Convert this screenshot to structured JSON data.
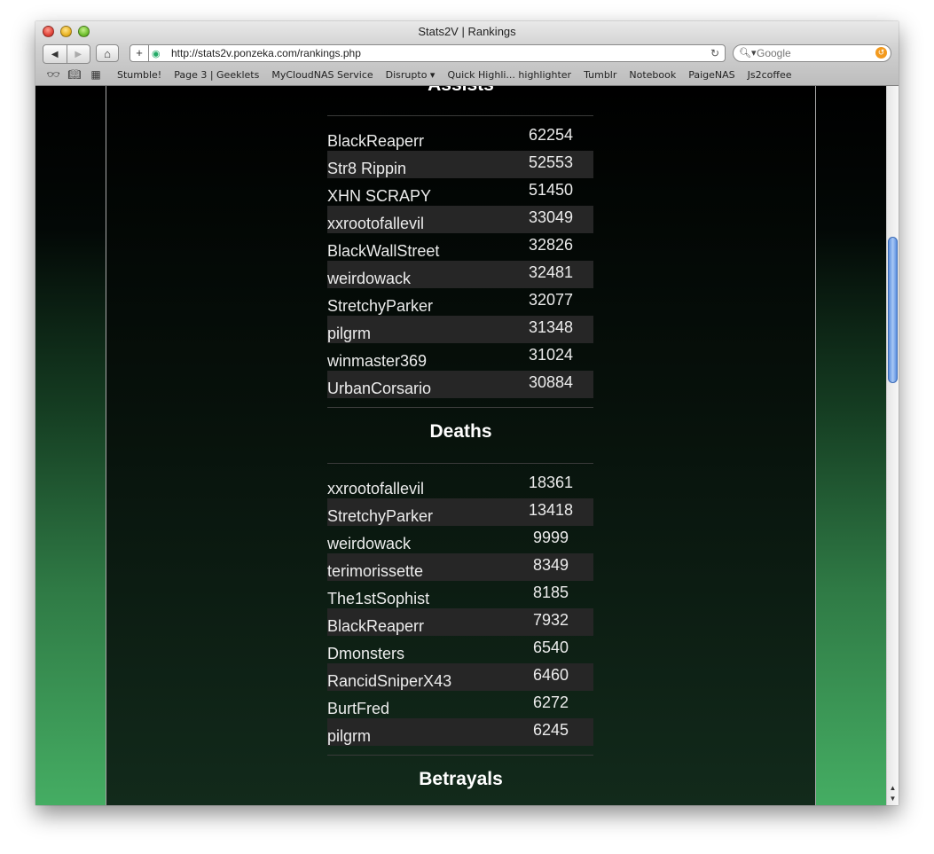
{
  "window": {
    "title": "Stats2V | Rankings"
  },
  "toolbar": {
    "url": "http://stats2v.ponzeka.com/rankings.php",
    "search_placeholder": "Google"
  },
  "bookmarks": [
    "Stumble!",
    "Page 3 | Geeklets",
    "MyCloudNAS Service",
    "Disrupto ▾",
    "Quick Highli... highlighter",
    "Tumblr",
    "Notebook",
    "PaigeNAS",
    "Js2coffee"
  ],
  "sections": {
    "assists": {
      "title": "Assists",
      "rows": [
        {
          "name": "BlackReaperr",
          "value": "62254"
        },
        {
          "name": "Str8 Rippin",
          "value": "52553"
        },
        {
          "name": "XHN SCRAPY",
          "value": "51450"
        },
        {
          "name": "xxrootofallevil",
          "value": "33049"
        },
        {
          "name": "BlackWallStreet",
          "value": "32826"
        },
        {
          "name": "weirdowack",
          "value": "32481"
        },
        {
          "name": "StretchyParker",
          "value": "32077"
        },
        {
          "name": "pilgrm",
          "value": "31348"
        },
        {
          "name": "winmaster369",
          "value": "31024"
        },
        {
          "name": "UrbanCorsario",
          "value": "30884"
        }
      ]
    },
    "deaths": {
      "title": "Deaths",
      "rows": [
        {
          "name": "xxrootofallevil",
          "value": "18361"
        },
        {
          "name": "StretchyParker",
          "value": "13418"
        },
        {
          "name": "weirdowack",
          "value": "9999"
        },
        {
          "name": "terimorissette",
          "value": "8349"
        },
        {
          "name": "The1stSophist",
          "value": "8185"
        },
        {
          "name": "BlackReaperr",
          "value": "7932"
        },
        {
          "name": "Dmonsters",
          "value": "6540"
        },
        {
          "name": "RancidSniperX43",
          "value": "6460"
        },
        {
          "name": "BurtFred",
          "value": "6272"
        },
        {
          "name": "pilgrm",
          "value": "6245"
        }
      ]
    },
    "betrayals": {
      "title": "Betrayals"
    }
  }
}
